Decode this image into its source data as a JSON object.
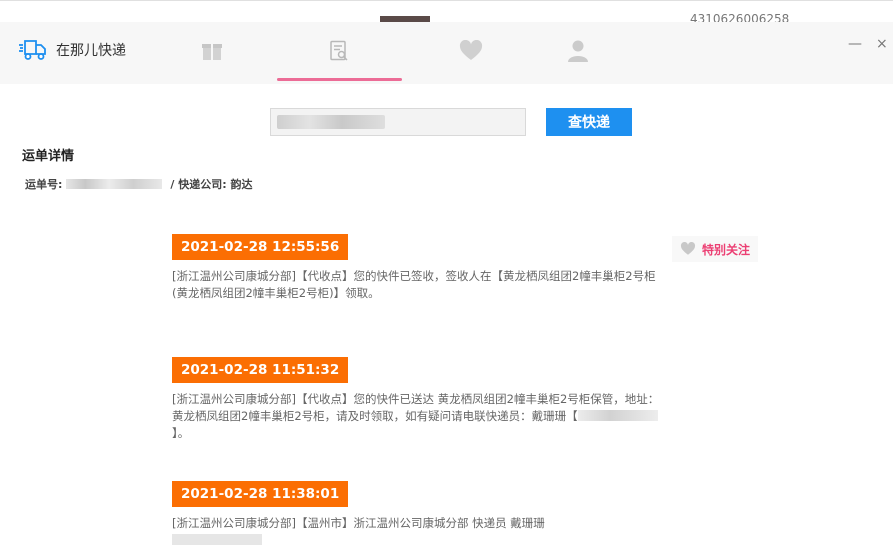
{
  "background_window": {
    "partial_text": "4310626006258"
  },
  "app": {
    "name": "在那儿快递"
  },
  "nav": {
    "icons": [
      "gift-icon",
      "document-search-icon",
      "heart-icon",
      "user-icon"
    ],
    "active_index": 1,
    "active_color": "#ec6c96"
  },
  "window_controls": {
    "minimize": "—",
    "close": "×"
  },
  "search": {
    "value": "",
    "button_label": "查快递",
    "button_color": "#1e90f0"
  },
  "detail": {
    "title": "运单详情",
    "tracking_label": "运单号:",
    "courier_text": "/ 快递公司: 韵达"
  },
  "follow": {
    "label": "特别关注",
    "color": "#ec3f73"
  },
  "timeline": {
    "stamp_color": "#fb6e03",
    "entries": [
      {
        "time": "2021-02-28 12:55:56",
        "desc": "[浙江温州公司康城分部]【代收点】您的快件已签收，签收人在【黄龙栖凤组团2幢丰巢柜2号柜(黄龙栖凤组团2幢丰巢柜2号柜)】领取。"
      },
      {
        "time": "2021-02-28 11:51:32",
        "desc": "[浙江温州公司康城分部]【代收点】您的快件已送达 黄龙栖凤组团2幢丰巢柜2号柜保管，地址：黄龙栖凤组团2幢丰巢柜2号柜，请及时领取，如有疑问请电联快递员：戴珊珊【",
        "desc_end": "】。"
      },
      {
        "time": "2021-02-28 11:38:01",
        "desc": "[浙江温州公司康城分部]【温州市】浙江温州公司康城分部 快递员 戴珊珊"
      }
    ]
  }
}
